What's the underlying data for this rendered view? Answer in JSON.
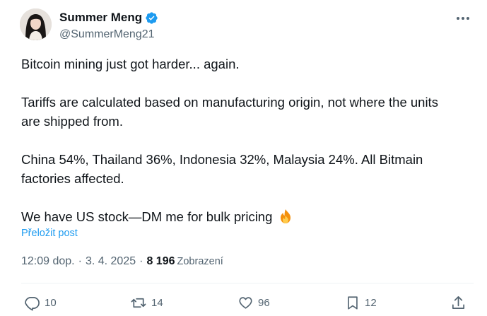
{
  "author": {
    "display_name": "Summer Meng",
    "handle": "@SummerMeng21",
    "verified": true
  },
  "tweet": {
    "paragraphs": [
      [
        "Bitcoin mining just got harder... again."
      ],
      [
        "Tariffs are calculated based on manufacturing origin, not where the units",
        "are shipped from."
      ],
      [
        "China 54%, Thailand 36%, Indonesia 32%, Malaysia 24%. All Bitmain",
        "factories affected."
      ],
      [
        "We have US stock—DM me for bulk pricing"
      ]
    ],
    "emoji": "fire"
  },
  "translate_label": "Přeložit post",
  "meta": {
    "time": "12:09 dop.",
    "separator": "·",
    "date": "3. 4. 2025",
    "views_count": "8 196",
    "views_label": "Zobrazení"
  },
  "actions": {
    "replies": "10",
    "reposts": "14",
    "likes": "96",
    "bookmarks": "12"
  },
  "colors": {
    "accent": "#1d9bf0",
    "secondary_text": "#536471",
    "primary_text": "#0f1419",
    "divider": "#eff3f4"
  },
  "icons": {
    "more": "more-horizontal-icon",
    "verified": "verified-badge-icon",
    "reply": "reply-icon",
    "repost": "repost-icon",
    "like": "heart-icon",
    "bookmark": "bookmark-icon",
    "share": "share-icon"
  }
}
